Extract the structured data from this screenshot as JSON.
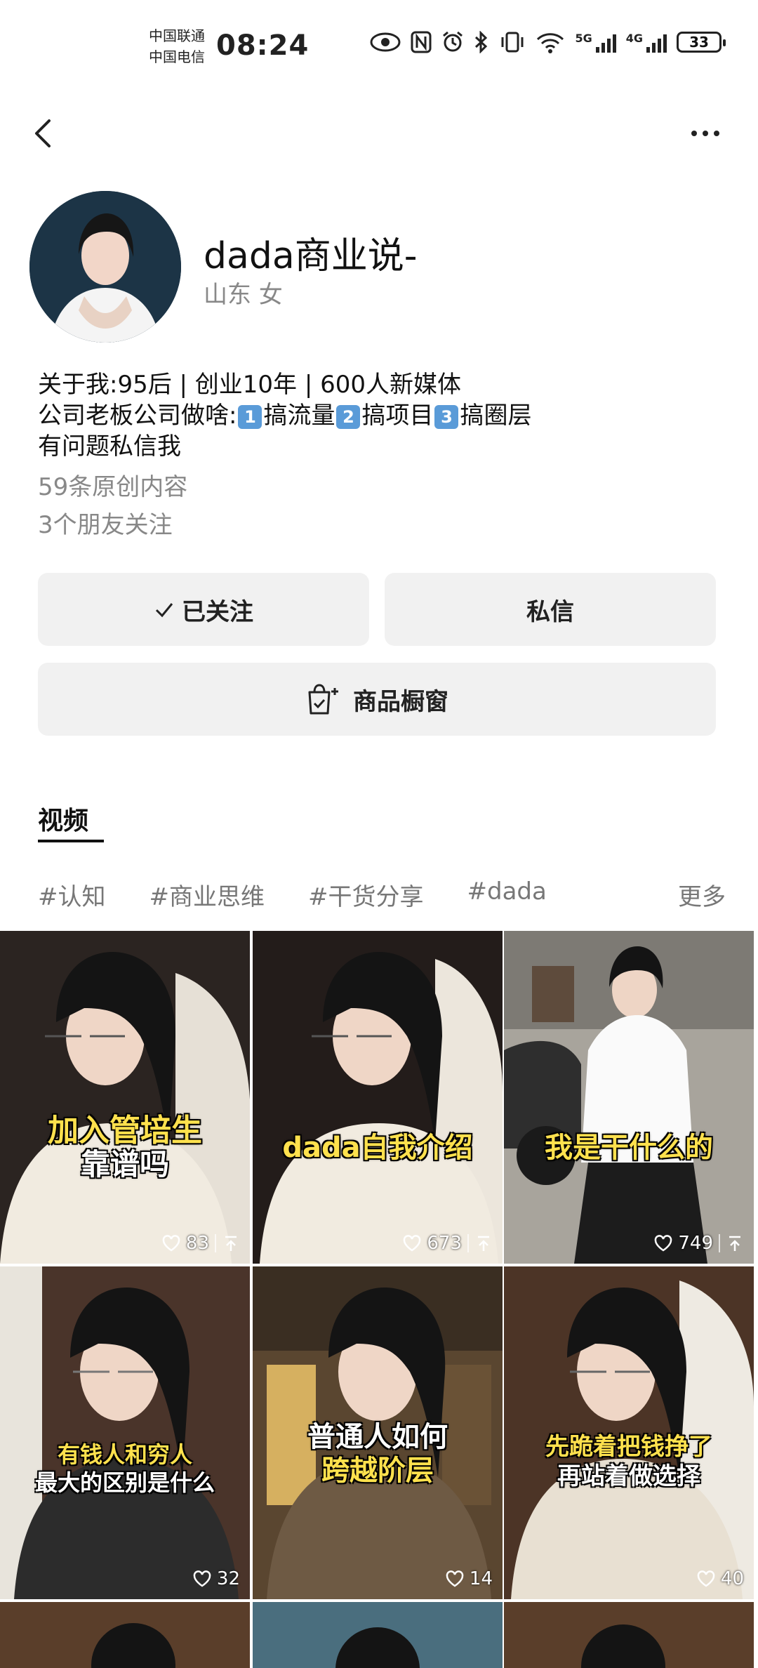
{
  "status_bar": {
    "carrier_1": "中国联通",
    "carrier_2": "中国电信",
    "time": "08:24",
    "net_1": "5G",
    "net_2": "4G",
    "battery": "33"
  },
  "profile": {
    "name": "dada商业说-",
    "location": "山东 女",
    "bio_line_1": "关于我:95后 | 创业10年 | 600人新媒体",
    "bio_line_2_prefix": "公司老板公司做啥:",
    "bio_items": [
      {
        "num": "1",
        "text": "搞流量"
      },
      {
        "num": "2",
        "text": "搞项目"
      },
      {
        "num": "3",
        "text": "搞圈层"
      }
    ],
    "bio_line_3": "有问题私信我",
    "original_count": "59条原创内容",
    "friends_follow": "3个朋友关注"
  },
  "actions": {
    "following_label": "已关注",
    "message_label": "私信",
    "shop_label": "商品橱窗"
  },
  "tabs": {
    "videos": "视频"
  },
  "tags": [
    "#认知",
    "#商业思维",
    "#干货分享",
    "#dada"
  ],
  "tags_more": "更多",
  "videos": [
    {
      "caption_1": "加入管培生",
      "caption_2": "靠谱吗",
      "likes": "83"
    },
    {
      "caption_1": "dada自我介绍",
      "caption_2": "",
      "likes": "673"
    },
    {
      "caption_1": "我是干什么的",
      "caption_2": "",
      "likes": "749"
    },
    {
      "caption_1": "有钱人和穷人",
      "caption_2": "最大的区别是什么",
      "likes": "32"
    },
    {
      "caption_1": "普通人如何",
      "caption_2": "跨越阶层",
      "likes": "14"
    },
    {
      "caption_1": "先跪着把钱挣了",
      "caption_2": "再站着做选择",
      "likes": "40"
    }
  ],
  "icons": {
    "back": "back-arrow-icon",
    "more": "more-dots-icon",
    "check": "check-icon",
    "shop": "shopping-bag-icon",
    "like": "heart-icon",
    "share": "share-icon"
  }
}
